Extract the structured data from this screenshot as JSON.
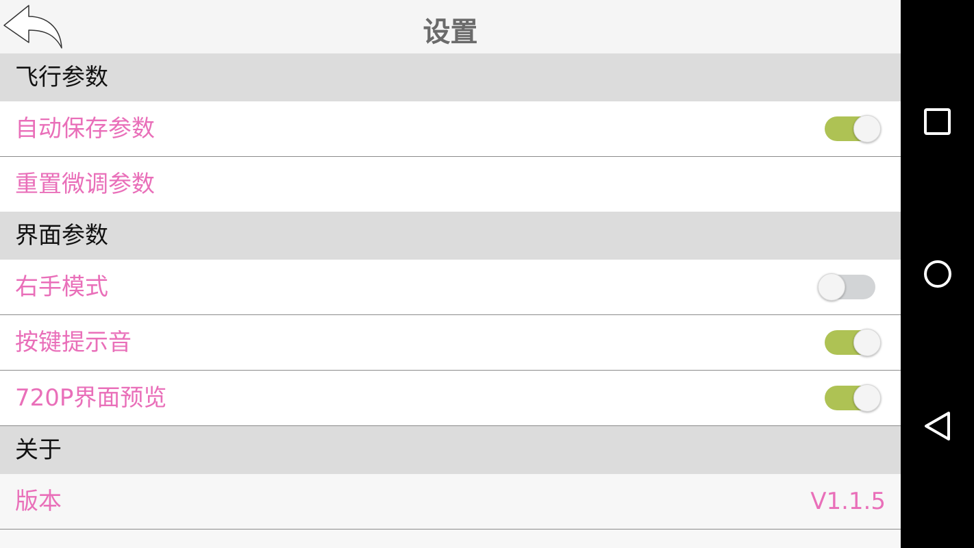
{
  "header": {
    "title": "设置",
    "back_icon": "back-arrow-icon"
  },
  "sections": {
    "flight": {
      "title": "飞行参数",
      "auto_save": {
        "label": "自动保存参数",
        "toggle": "on"
      },
      "reset_trim": {
        "label": "重置微调参数"
      }
    },
    "interface": {
      "title": "界面参数",
      "right_hand": {
        "label": "右手模式",
        "toggle": "off"
      },
      "key_sound": {
        "label": "按键提示音",
        "toggle": "on"
      },
      "preview_720p": {
        "label": "720P界面预览",
        "toggle": "on"
      }
    },
    "about": {
      "title": "关于",
      "version": {
        "label": "版本",
        "value": "V1.1.5"
      }
    }
  },
  "navbar": {
    "recents_icon": "square-recents-icon",
    "home_icon": "circle-home-icon",
    "back_icon": "triangle-back-icon"
  },
  "colors": {
    "accent_pink": "#e96fb9",
    "toggle_on": "#aec254",
    "toggle_off": "#d2d4d6",
    "section_bg": "#dcdcdc",
    "title_gray": "#6a6a6a"
  }
}
